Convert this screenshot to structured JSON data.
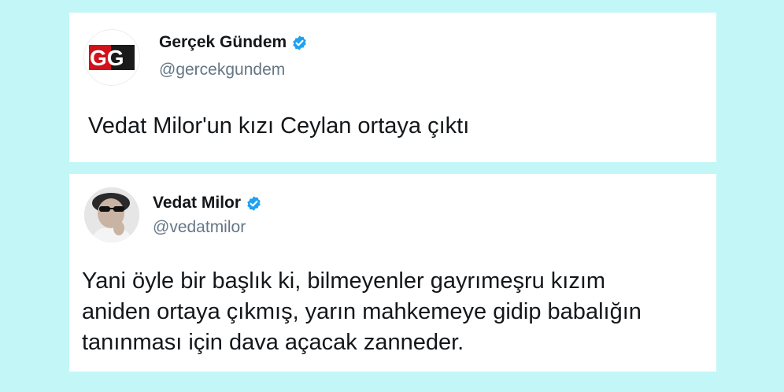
{
  "tweets": [
    {
      "name": "Gerçek Gündem",
      "handle": "@gercekgundem",
      "verified": true,
      "avatar_text": "GG",
      "text": "Vedat Milor'un kızı Ceylan ortaya çıktı"
    },
    {
      "name": "Vedat Milor",
      "handle": "@vedatmilor",
      "verified": true,
      "text_lines": [
        "Yani öyle bir başlık ki, bilmeyenler gayrımeşru kızım",
        "aniden ortaya çıkmış, yarın mahkemeye gidip babalığın",
        "tanınması için dava açacak zanneder."
      ]
    }
  ],
  "colors": {
    "background": "#c3f7f7",
    "verified": "#1da1f2",
    "gg_red": "#d0121b"
  }
}
